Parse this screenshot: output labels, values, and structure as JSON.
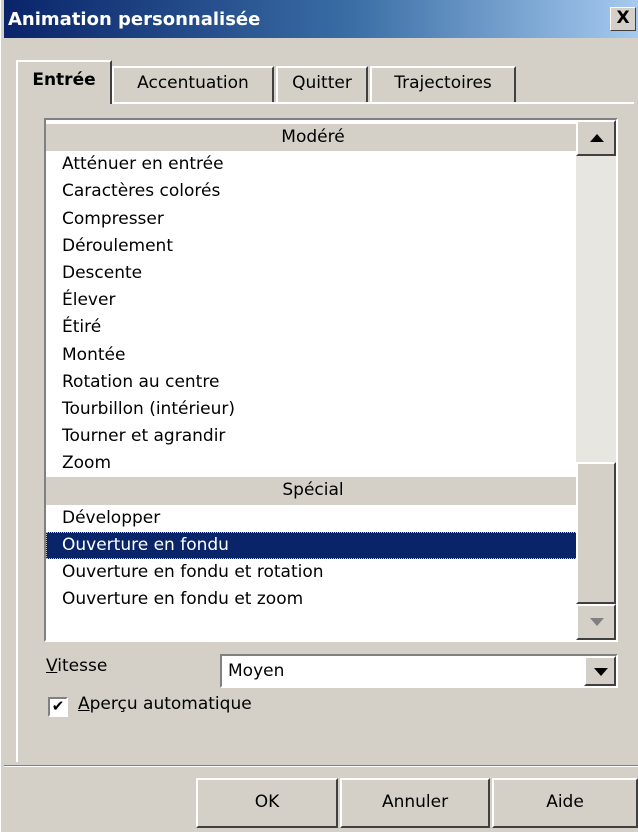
{
  "window": {
    "title": "Animation personnalisée",
    "close_glyph": "X"
  },
  "tabs": [
    {
      "label": "Entrée",
      "active": true
    },
    {
      "label": "Accentuation",
      "active": false
    },
    {
      "label": "Quitter",
      "active": false
    },
    {
      "label": "Trajectoires",
      "active": false
    }
  ],
  "effects_list": {
    "groups": [
      {
        "header": "Modéré",
        "items": [
          "Atténuer en entrée",
          "Caractères colorés",
          "Compresser",
          "Déroulement",
          "Descente",
          "Élever",
          "Étiré",
          "Montée",
          "Rotation au centre",
          "Tourbillon (intérieur)",
          "Tourner et agrandir",
          "Zoom"
        ]
      },
      {
        "header": "Spécial",
        "items": [
          "Développer",
          "Ouverture en fondu",
          "Ouverture en fondu et rotation",
          "Ouverture en fondu et zoom"
        ]
      }
    ],
    "selected": "Ouverture en fondu",
    "scroll_up_icon": "scroll-up-arrow",
    "scroll_down_icon": "scroll-down-arrow"
  },
  "speed": {
    "label_mnemonic": "V",
    "label_rest": "itesse",
    "value": "Moyen",
    "dropdown_icon": "chevron-down"
  },
  "autopreview": {
    "label_mnemonic": "A",
    "label_rest": "perçu automatique",
    "checked": true,
    "check_glyph": "✔"
  },
  "buttons": {
    "ok": "OK",
    "cancel": "Annuler",
    "help": "Aide"
  },
  "colors": {
    "selection": "#0a246a",
    "titlebar_start": "#0a246a",
    "titlebar_end": "#a6caf0",
    "face": "#d4d0c8"
  }
}
